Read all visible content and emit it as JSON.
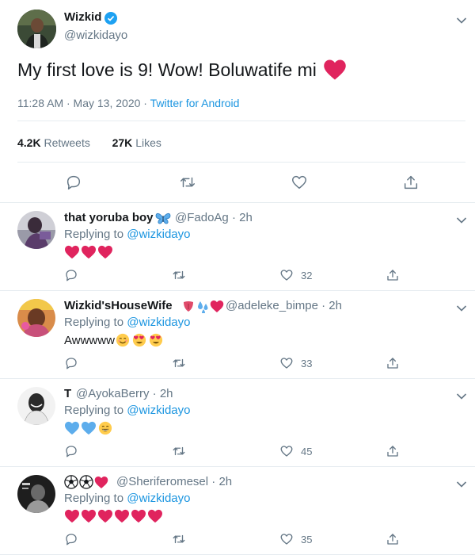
{
  "tweet": {
    "author_name": "Wizkid",
    "author_handle": "@wizkidayo",
    "text": "My first love is 9! Wow! Boluwatife mi",
    "time": "11:28 AM · May 13, 2020 ·",
    "source": "Twitter for Android",
    "retweets_count": "4.2K",
    "retweets_label": "Retweets",
    "likes_count": "27K",
    "likes_label": "Likes"
  },
  "replies": [
    {
      "name": "that yoruba boy",
      "handle": "@FadoAg",
      "time": "· 2h",
      "replying_prefix": "Replying to",
      "replying_to": "@wizkidayo",
      "emoji": [
        "red-heart",
        "red-heart",
        "red-heart"
      ],
      "like_count": "32"
    },
    {
      "name": "Wizkid'sHouseWife",
      "handle": "@adeleke_bimpe",
      "time": "· 2h",
      "replying_prefix": "Replying to",
      "replying_to": "@wizkidayo",
      "text": "Awwwww",
      "emoji": [
        "smiling-face",
        "heart-eyes-face",
        "heart-eyes-face"
      ],
      "like_count": "33"
    },
    {
      "name": "T",
      "handle": "@AyokaBerry",
      "time": "· 2h",
      "replying_prefix": "Replying to",
      "replying_to": "@wizkidayo",
      "emoji": [
        "blue-heart",
        "blue-heart",
        "grinning-face"
      ],
      "like_count": "45"
    },
    {
      "name": "",
      "handle": "@Sheriferomesel",
      "time": "· 2h",
      "replying_prefix": "Replying to",
      "replying_to": "@wizkidayo",
      "emoji": [
        "red-heart",
        "red-heart",
        "red-heart",
        "red-heart",
        "red-heart",
        "red-heart"
      ],
      "like_count": "35"
    }
  ],
  "colors": {
    "accent": "#1b95e0",
    "verified": "#1da1f2",
    "secondary_text": "#657786",
    "heart": "#e0245e"
  }
}
